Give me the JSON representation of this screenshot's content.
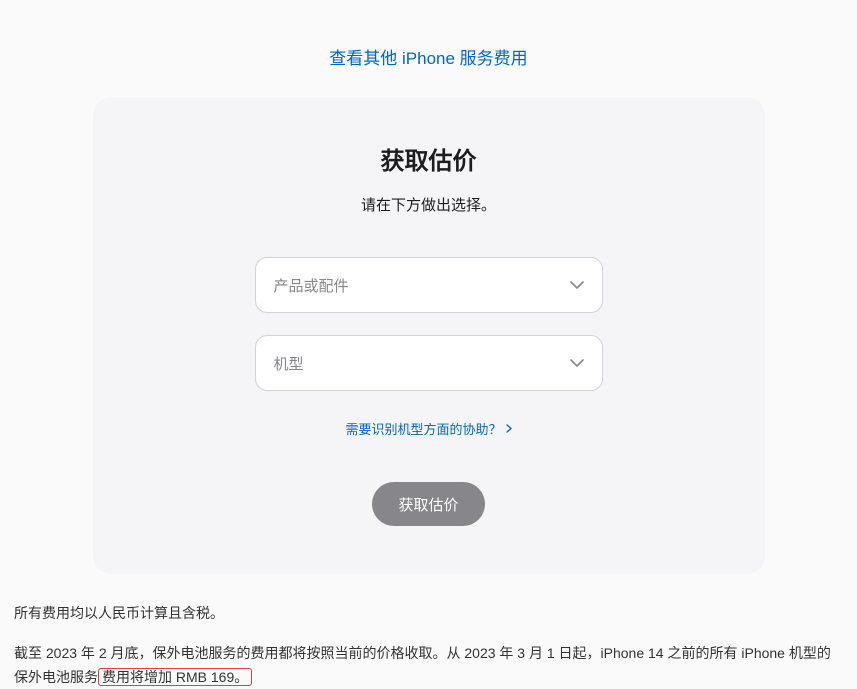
{
  "topLink": {
    "label": "查看其他 iPhone 服务费用"
  },
  "card": {
    "title": "获取估价",
    "subtitle": "请在下方做出选择。",
    "select1": {
      "placeholder": "产品或配件"
    },
    "select2": {
      "placeholder": "机型"
    },
    "helpLink": {
      "label": "需要识别机型方面的协助？"
    },
    "button": {
      "label": "获取估价"
    }
  },
  "footer": {
    "line1": "所有费用均以人民币计算且含税。",
    "line2_part1": "截至 2023 年 2 月底，保外电池服务的费用都将按照当前的价格收取。从 2023 年 3 月 1 日起，iPhone 14 之前的所有 iPhone 机型的保外电池服务",
    "line2_highlight": "费用将增加 RMB 169。"
  }
}
